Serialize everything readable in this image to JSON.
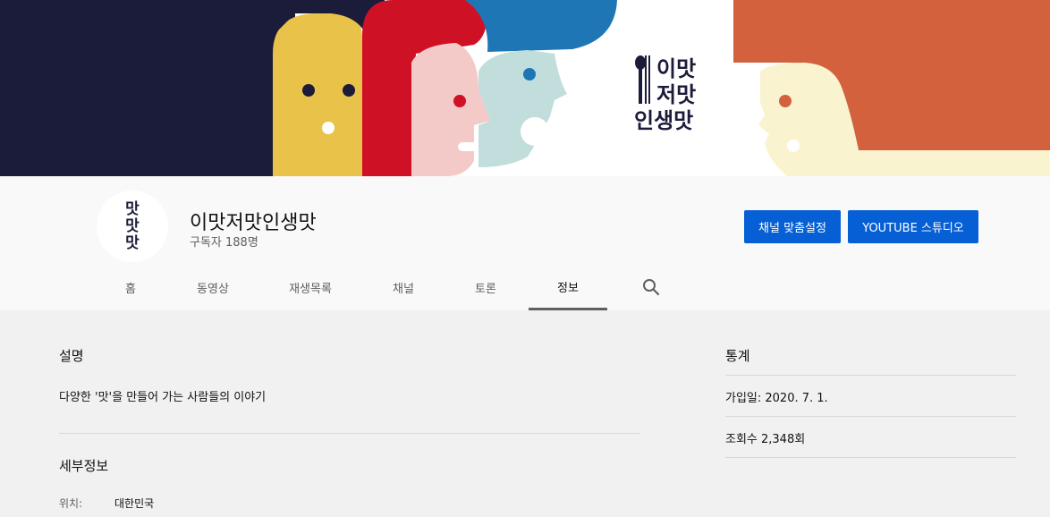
{
  "banner": {
    "logo_line1": "이맛",
    "logo_line2": "저맛",
    "logo_line3": "인생맛"
  },
  "channel": {
    "avatar_text": "맛맛맛",
    "name": "이맛저맛인생맛",
    "subscribers": "구독자 188명"
  },
  "buttons": {
    "customize": "채널 맞춤설정",
    "studio": "YOUTUBE 스튜디오"
  },
  "tabs": [
    {
      "label": "홈"
    },
    {
      "label": "동영상"
    },
    {
      "label": "재생목록"
    },
    {
      "label": "채널"
    },
    {
      "label": "토론"
    },
    {
      "label": "정보",
      "active": true
    }
  ],
  "about": {
    "description_title": "설명",
    "description_text": "다양한 '맛'을 만들어 가는 사람들의 이야기",
    "details_title": "세부정보",
    "location_label": "위치:",
    "location_value": "대한민국"
  },
  "stats": {
    "title": "통계",
    "joined": "가입일: 2020. 7. 1.",
    "views": "조회수 2,348회"
  },
  "icons": {
    "search": "search-icon"
  },
  "colors": {
    "accent": "#065fd4",
    "navy": "#1b1b3a",
    "yellow": "#e9c349",
    "red": "#cf1126",
    "pink": "#f3cac8",
    "mint": "#c1dedd",
    "blue": "#1e77b4",
    "orange": "#d3613e",
    "cream": "#faf3cf"
  }
}
